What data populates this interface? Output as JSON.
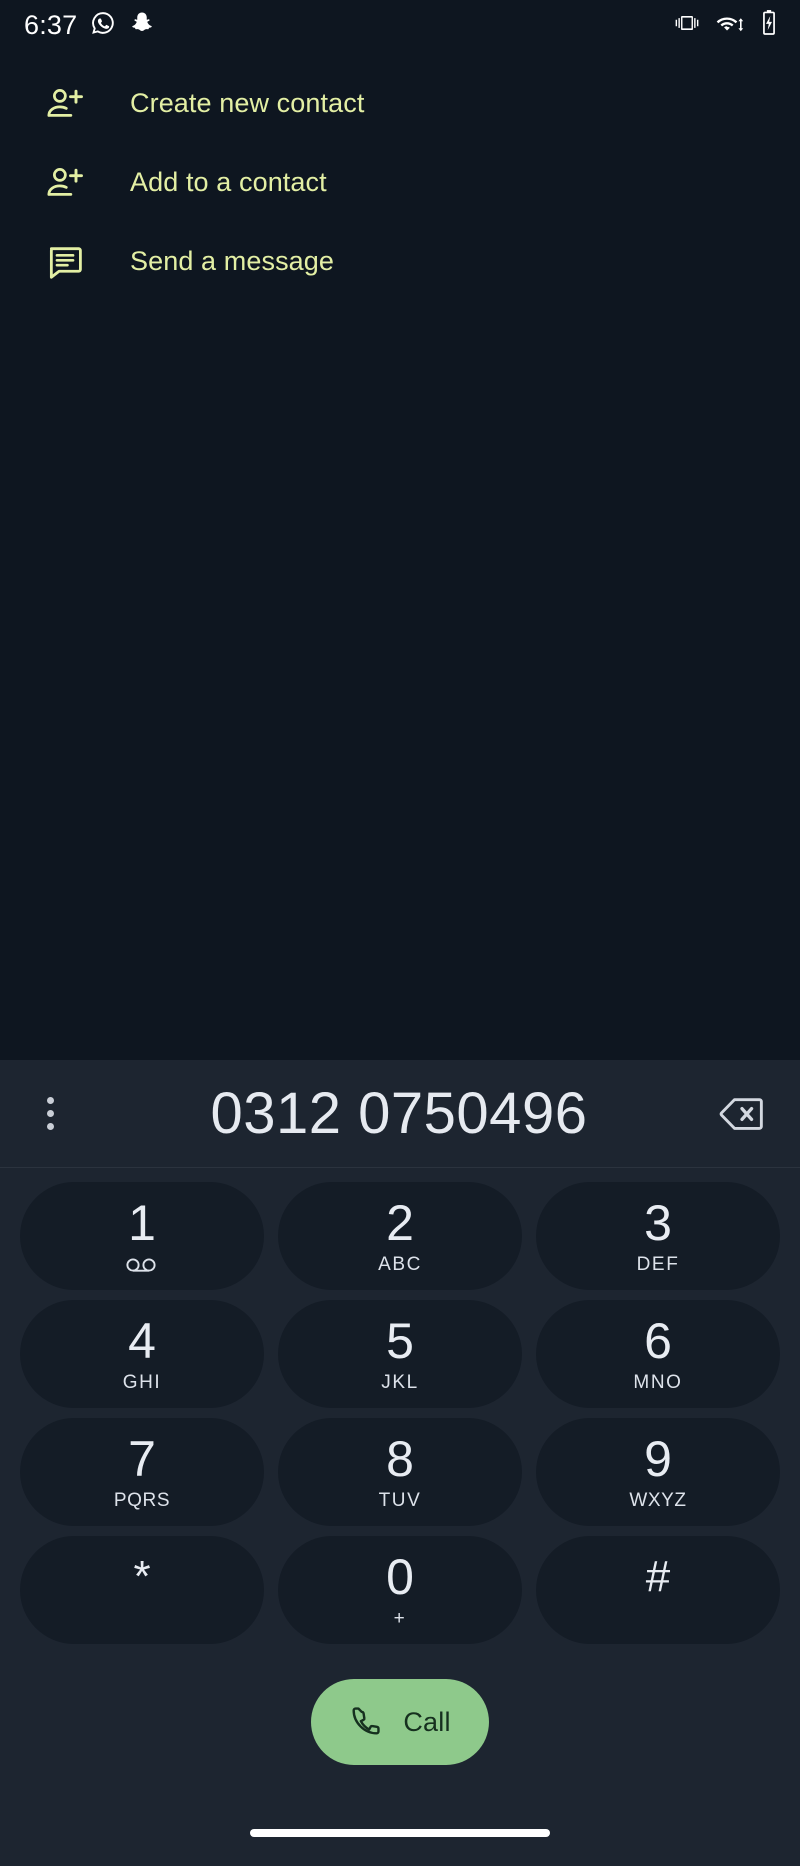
{
  "status_bar": {
    "time": "6:37",
    "left_icons": [
      "whatsapp-icon",
      "snapchat-icon"
    ],
    "right_icons": [
      "vibrate-icon",
      "wifi-icon",
      "battery-charging-icon"
    ]
  },
  "suggestions": {
    "items": [
      {
        "icon": "person-add-icon",
        "label": "Create new contact"
      },
      {
        "icon": "person-add-icon",
        "label": "Add to a contact"
      },
      {
        "icon": "message-icon",
        "label": "Send a message"
      }
    ]
  },
  "number_bar": {
    "overflow_icon": "more-vert-icon",
    "dialed_number": "0312 0750496",
    "backspace_icon": "backspace-icon"
  },
  "keypad": {
    "keys": [
      {
        "digit": "1",
        "sub": "",
        "sub_icon": "voicemail-icon"
      },
      {
        "digit": "2",
        "sub": "ABC",
        "sub_icon": ""
      },
      {
        "digit": "3",
        "sub": "DEF",
        "sub_icon": ""
      },
      {
        "digit": "4",
        "sub": "GHI",
        "sub_icon": ""
      },
      {
        "digit": "5",
        "sub": "JKL",
        "sub_icon": ""
      },
      {
        "digit": "6",
        "sub": "MNO",
        "sub_icon": ""
      },
      {
        "digit": "7",
        "sub": "PQRS",
        "sub_icon": ""
      },
      {
        "digit": "8",
        "sub": "TUV",
        "sub_icon": ""
      },
      {
        "digit": "9",
        "sub": "WXYZ",
        "sub_icon": ""
      },
      {
        "digit": "*",
        "sub": "",
        "sub_icon": ""
      },
      {
        "digit": "0",
        "sub": "+",
        "sub_icon": ""
      },
      {
        "digit": "#",
        "sub": "",
        "sub_icon": ""
      }
    ]
  },
  "call_button": {
    "label": "Call",
    "icon": "phone-icon",
    "color": "#8ec98b"
  },
  "navigation": {
    "gesture_pill": "home-gesture-bar"
  },
  "colors": {
    "background": "#0e1620",
    "panel": "#1d2530",
    "key": "#141c26",
    "accent_text": "#e3efa4",
    "primary_text": "#e6eaf0",
    "call_green": "#8ec98b"
  }
}
